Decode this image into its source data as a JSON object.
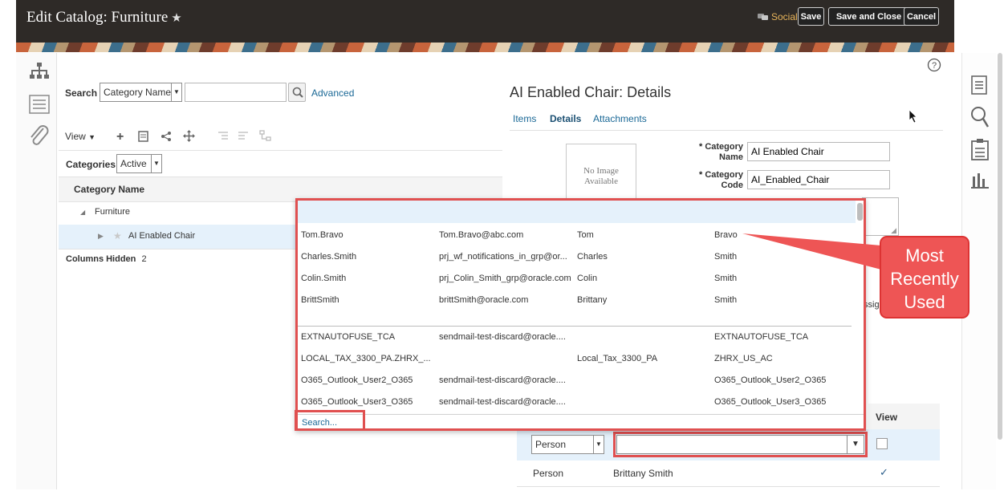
{
  "header": {
    "title": "Edit Catalog: Furniture",
    "social_label": "Social",
    "save_label": "Save",
    "save_close_label": "Save and Close",
    "cancel_label": "Cancel"
  },
  "search": {
    "label": "Search",
    "field_value": "Category Name",
    "input_value": "",
    "advanced_label": "Advanced"
  },
  "toolbar": {
    "view_label": "View"
  },
  "categories": {
    "label": "Categories",
    "value": "Active"
  },
  "tree": {
    "column_header": "Category Name",
    "rows": [
      {
        "label": "Furniture"
      },
      {
        "label": "AI Enabled Chair"
      }
    ],
    "columns_hidden_label": "Columns Hidden",
    "columns_hidden_count": "2"
  },
  "details": {
    "title": "AI Enabled Chair: Details",
    "tabs": [
      "Items",
      "Details",
      "Attachments"
    ],
    "no_image_line1": "No Image",
    "no_image_line2": "Available",
    "category_name_label1": "Category",
    "category_name_label2": "Name",
    "category_name_value": "AI Enabled Chair",
    "category_code_label1": "Category",
    "category_code_label2": "Code",
    "category_code_value": "AI_Enabled_Chair",
    "partial_label": "ssig"
  },
  "lookup_popup": {
    "recent_rows": [
      [
        "Tom.Bravo",
        "Tom.Bravo@abc.com",
        "Tom",
        "Bravo"
      ],
      [
        "Charles.Smith",
        "prj_wf_notifications_in_grp@or...",
        "Charles",
        "Smith"
      ],
      [
        "Colin.Smith",
        "prj_Colin_Smith_grp@oracle.com",
        "Colin",
        "Smith"
      ],
      [
        "BrittSmith",
        "brittSmith@oracle.com",
        "Brittany",
        "Smith"
      ]
    ],
    "other_rows": [
      [
        "EXTNAUTOFUSE_TCA",
        "sendmail-test-discard@oracle....",
        "",
        "EXTNAUTOFUSE_TCA"
      ],
      [
        "LOCAL_TAX_3300_PA.ZHRX_...",
        "",
        "Local_Tax_3300_PA",
        "ZHRX_US_AC"
      ],
      [
        "O365_Outlook_User2_O365",
        "sendmail-test-discard@oracle....",
        "",
        "O365_Outlook_User2_O365"
      ],
      [
        "O365_Outlook_User3_O365",
        "sendmail-test-discard@oracle....",
        "",
        "O365_Outlook_User3_O365"
      ]
    ],
    "search_link": "Search..."
  },
  "access_table": {
    "view_header": "View",
    "type_select_value": "Person",
    "name_select_value": "",
    "row_type": "Person",
    "row_name": "Brittany Smith",
    "row_check": "✓"
  },
  "callout": {
    "line1": "Most",
    "line2": "Recently",
    "line3": "Used"
  },
  "colors": {
    "header_bg": "#2e2a27",
    "link": "#1a6896",
    "highlight": "#e05050",
    "selected_row": "#e5f1fb"
  }
}
